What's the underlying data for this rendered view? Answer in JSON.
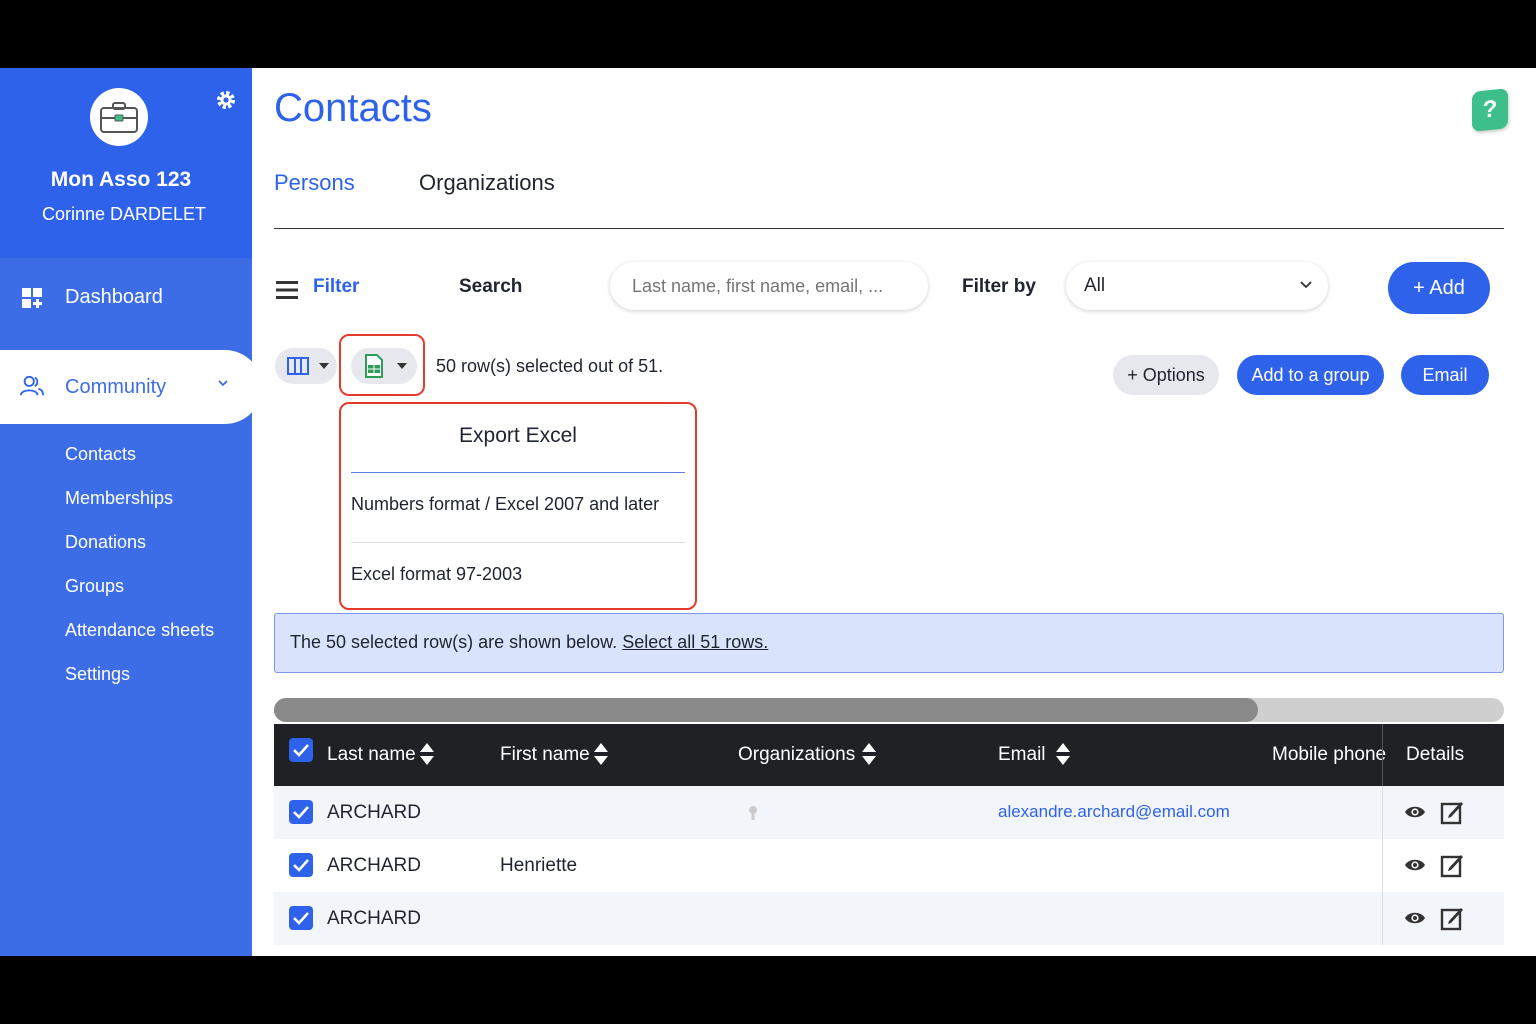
{
  "sidebar": {
    "org_name": "Mon Asso 123",
    "user_name": "Corinne DARDELET",
    "nav": {
      "dashboard": "Dashboard",
      "community": "Community"
    },
    "sub_items": [
      "Contacts",
      "Memberships",
      "Donations",
      "Groups",
      "Attendance sheets",
      "Settings"
    ]
  },
  "page": {
    "title": "Contacts",
    "help": "?",
    "tabs": [
      "Persons",
      "Organizations"
    ]
  },
  "toolbar": {
    "filter_label": "Filter",
    "search_label": "Search",
    "search_placeholder": "Last name, first name, email, ...",
    "filter_by_label": "Filter by",
    "filter_by_value": "All",
    "add_label": "+ Add",
    "selection_text": "50 row(s) selected out of 51.",
    "options_label": "+ Options",
    "add_group_label": "Add to a group",
    "email_label": "Email"
  },
  "export_menu": {
    "title": "Export Excel",
    "options": [
      "Numbers format / Excel 2007 and later",
      "Excel format 97-2003"
    ]
  },
  "info_bar": {
    "text": "The 50 selected row(s) are shown below.",
    "link": "Select all 51 rows."
  },
  "table": {
    "columns": [
      "Last name",
      "First name",
      "Organizations",
      "Email",
      "Mobile phone",
      "Details"
    ],
    "rows": [
      {
        "last_name": "ARCHARD",
        "first_name": "",
        "email": "alexandre.archard@email.com"
      },
      {
        "last_name": "ARCHARD",
        "first_name": "Henriette",
        "email": ""
      },
      {
        "last_name": "ARCHARD",
        "first_name": "",
        "email": ""
      }
    ]
  },
  "colors": {
    "brand": "#2f62ea",
    "sidebar": "#3c6de6",
    "highlight": "#e53b2c",
    "help": "#3dbf8c"
  }
}
